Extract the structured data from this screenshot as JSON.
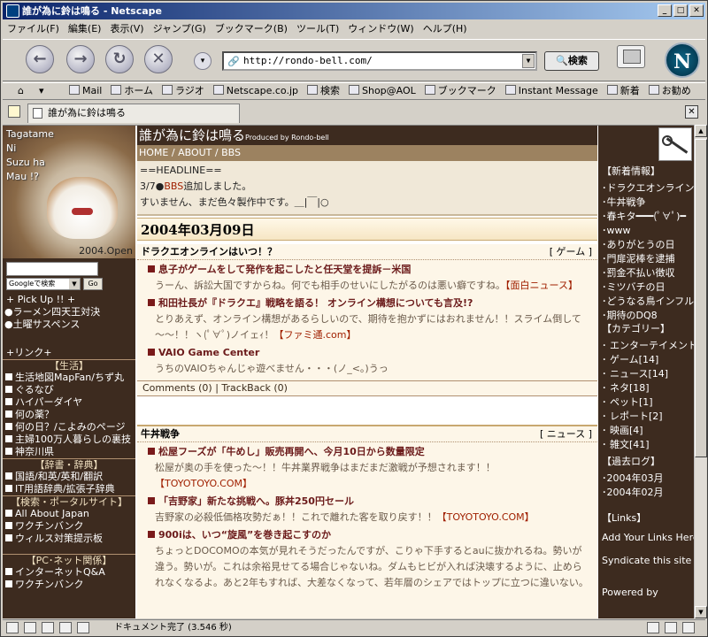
{
  "window": {
    "title": "誰が為に鈴は鳴る - Netscape"
  },
  "menu": [
    "ファイル(F)",
    "編集(E)",
    "表示(V)",
    "ジャンプ(G)",
    "ブックマーク(B)",
    "ツール(T)",
    "ウィンドウ(W)",
    "ヘルプ(H)"
  ],
  "nav": {
    "url": "http://rondo-bell.com/",
    "search_label": "検索",
    "logo_letter": "N"
  },
  "bookmarks": [
    "Mail",
    "ホーム",
    "ラジオ",
    "Netscape.co.jp",
    "検索",
    "Shop@AOL",
    "ブックマーク",
    "Instant Message",
    "新着",
    "お勧め"
  ],
  "tab": {
    "title": "誰が為に鈴は鳴る"
  },
  "status": {
    "text": "ドキュメント完了 (3.546 秒)"
  },
  "left": {
    "photo_lines": [
      "Tagatame",
      "Ni",
      "Suzu ha",
      "Mau !?"
    ],
    "photo_date": "2004.Open",
    "search_select": "Googleで検索",
    "go_label": "Go",
    "pickup": [
      "+ Pick Up !! +",
      "●ラーメン四天王対決",
      "●土曜サスペンス"
    ],
    "links_header": "+リンク+",
    "life_header": "【生活】",
    "life_items": [
      "生活地図MapFan/ちず丸",
      "ぐるなび",
      "ハイパーダイヤ",
      "何の薬？",
      "何の日？/こよみのページ",
      "主婦100万人暮らしの裏技",
      "神奈川県"
    ],
    "dict_header": "【辞書・辞典】",
    "dict_items": [
      "国語/和英/英和/翻訳",
      "IT用語辞典/拡張子辞典"
    ],
    "portal_header": "【検索・ポータルサイト】",
    "portal_items": [
      "All About Japan",
      "ワクチンバンク",
      "ウィルス対策提示板"
    ],
    "pc_header": "【PC･ネット関係】",
    "pc_items": [
      "インターネットQ&A",
      "ワクチンバンク"
    ]
  },
  "main": {
    "site_title": "誰が為に鈴は鳴る",
    "site_sub": "Produced by Rondo-bell",
    "nav_links": "HOME / ABOUT / BBS",
    "headline_title": "==HEADLINE==",
    "headline_1_pre": "3/7●",
    "headline_1_link": "BBS",
    "headline_1_post": "追加しました。",
    "headline_2": "すいません、まだ色々製作中です。＿|￣|○",
    "date": "2004年03月09日",
    "entries": [
      {
        "title": "ドラクエオンラインはいつ！？",
        "category": "[ ゲーム ]",
        "articles": [
          {
            "title": "息子がゲームをして発作を起こしたと任天堂を提訴－米国",
            "body": "うーん、訴訟大国ですからね。何でも相手のせいにしたがるのは悪い癖ですね。",
            "src": "【面白ニュース】"
          },
          {
            "title": "和田社長が『ドラクエ』戦略を語る！ オンライン構想についても言及!?",
            "body": "とりあえず、オンライン構想があるらしいので、期待を抱かずにはおれません！！スライム倒して～～！！ヽ(ﾟ∀ﾟ)ノイェｨ！",
            "src": "【ファミ通.com】"
          },
          {
            "title": "VAIO Game Center",
            "body": "うちのVAIOちゃんじゃ遊べません・・・(ノ_<。)うっ",
            "src": ""
          }
        ],
        "comments": "Comments (0) | TrackBack (0)"
      },
      {
        "title": "牛丼戦争",
        "category": "[ ニュース ]",
        "articles": [
          {
            "title": "松屋フーズが「牛めし」販売再開へ、今月10日から数量限定",
            "body": "松屋が奥の手を使った～！！牛丼業界戦争はまだまだ激戦が予想されます！！",
            "src": "【TOYOTOYO.COM】"
          },
          {
            "title": "「吉野家」新たな挑戦へ。豚丼250円セール",
            "body": "吉野家の必殺低価格攻勢だぁ！！これで離れた客を取り戻す！！",
            "src": "【TOYOTOYO.COM】"
          },
          {
            "title": "900iは、いつ“旋風”を巻き起こすのか",
            "body": "ちょっとDOCOMOの本気が見れそうだったんですが、こりゃ下手するとauに抜かれるね。勢いが違う。勢いが。これは余裕見せてる場合じゃないね。ダムもヒビが入れば決壊するように、止められなくなるよ。あと2年もすれば、大差なくなって、若年層のシェアではトップに立つに違いない。",
            "src": ""
          }
        ]
      }
    ]
  },
  "right": {
    "new_header": "【新着情報】",
    "new_items": [
      "･ドラクエオンラインは",
      "･牛丼戦争",
      "･春キタ━━━(ﾟ∀ﾟ)━",
      "･www",
      "･ありがとうの日",
      "･門扉泥棒を逮捕",
      "･罰金不払い徴収",
      "･ミツバチの日",
      "･どうなる鳥インフル",
      "･期待のDQ8"
    ],
    "cat_header": "【カテゴリー】",
    "cat_items": [
      "･ エンターテイメント",
      "･ ゲーム[14]",
      "･ ニュース[14]",
      "･ ネタ[18]",
      "･ ペット[1]",
      "･ レポート[2]",
      "･ 映画[4]",
      "･ 雑文[41]"
    ],
    "archive_header": "【過去ログ】",
    "archive_items": [
      "･2004年03月",
      "･2004年02月"
    ],
    "links_header": "【Links】",
    "add_links": "Add Your Links Here",
    "syndicate": "Syndicate this site",
    "powered": "Powered by"
  }
}
